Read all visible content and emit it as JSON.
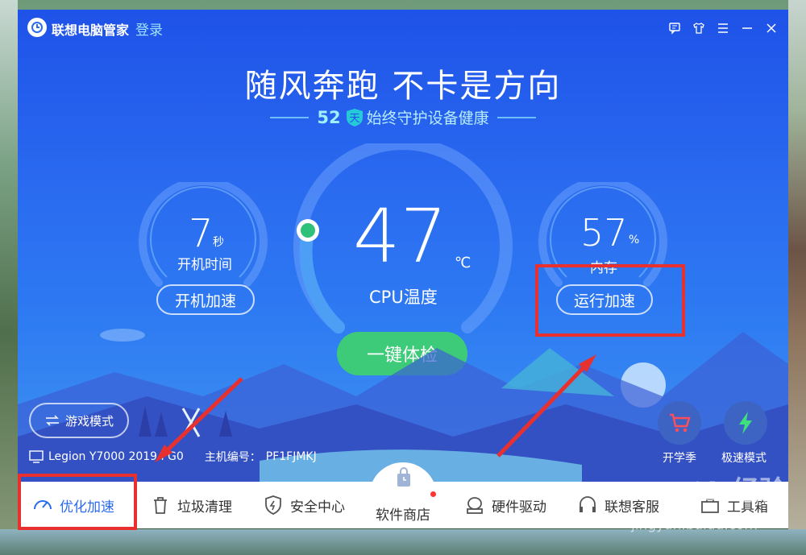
{
  "app": {
    "title": "联想电脑管家",
    "login": "登录"
  },
  "window_controls": [
    "feedback-icon",
    "skin-icon",
    "menu-icon",
    "minimize-icon",
    "close-icon"
  ],
  "headline": "随风奔跑 不卡是方向",
  "streak": {
    "days": "52",
    "day_char": "天",
    "text": "始终守护设备健康"
  },
  "boot": {
    "value": "7",
    "unit": "秒",
    "label": "开机时间",
    "button": "开机加速"
  },
  "cpu": {
    "value": "47",
    "unit": "℃",
    "label": "CPU温度",
    "button": "一键体检"
  },
  "memory": {
    "value": "57",
    "unit": "%",
    "label": "内存",
    "button": "运行加速"
  },
  "game_mode": "游戏模式",
  "device": {
    "model": "Legion Y7000 2019 PG0",
    "host_label": "主机编号：",
    "host_id": "PF1FJMKJ"
  },
  "quick": [
    {
      "label": "开学季",
      "icon": "cart-icon"
    },
    {
      "label": "极速模式",
      "icon": "lightning-icon"
    }
  ],
  "nav": [
    {
      "label": "优化加速",
      "icon": "speedometer-icon",
      "active": true
    },
    {
      "label": "垃圾清理",
      "icon": "trash-icon"
    },
    {
      "label": "安全中心",
      "icon": "shield-icon"
    },
    {
      "label": "软件商店",
      "icon": "store-bag-icon"
    },
    {
      "label": "硬件驱动",
      "icon": "hardware-icon"
    },
    {
      "label": "联想客服",
      "icon": "headset-icon"
    },
    {
      "label": "工具箱",
      "icon": "toolbox-icon"
    }
  ],
  "watermark": {
    "brand": "Baidu经验",
    "url": "jingyan.baidu.com"
  },
  "colors": {
    "accent": "#2a6bf0",
    "check_button": "#3ecb79",
    "highlight": "#e8312f",
    "cpu_indicator": "#2fc07a"
  }
}
